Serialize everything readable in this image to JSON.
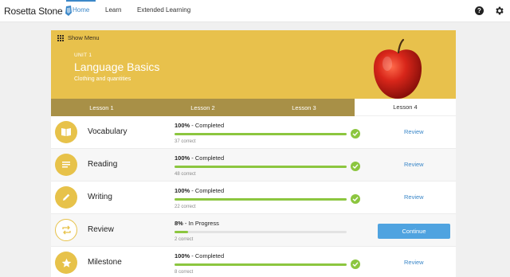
{
  "header": {
    "logo_text": "Rosetta Stone",
    "tabs": [
      "Home",
      "Learn",
      "Extended Learning"
    ],
    "help_symbol": "?",
    "icons": [
      "help-icon",
      "gear-icon"
    ]
  },
  "banner": {
    "show_menu_label": "Show Menu",
    "unit_label": "UNIT 1",
    "unit_title": "Language Basics",
    "unit_subtitle": "Clothing and quantities",
    "background_color": "#e8c14c"
  },
  "lessons": [
    "Lesson 1",
    "Lesson 2",
    "Lesson 3",
    "Lesson 4"
  ],
  "activities": [
    {
      "title": "Vocabulary",
      "percent": "100%",
      "status": " - Completed",
      "progress": 1.0,
      "correct": "37 correct",
      "action": "Review",
      "icon": "book-icon"
    },
    {
      "title": "Reading",
      "percent": "100%",
      "status": " - Completed",
      "progress": 1.0,
      "correct": "48 correct",
      "action": "Review",
      "icon": "document-lines-icon"
    },
    {
      "title": "Writing",
      "percent": "100%",
      "status": " - Completed",
      "progress": 1.0,
      "correct": "22 correct",
      "action": "Review",
      "icon": "pencil-icon"
    },
    {
      "title": "Review",
      "percent": "8%",
      "status": " - In Progress",
      "progress": 0.08,
      "correct": "2 correct",
      "action": "Continue",
      "icon": "repeat-arrows-icon"
    },
    {
      "title": "Milestone",
      "percent": "100%",
      "status": " - Completed",
      "progress": 1.0,
      "correct": "8 correct",
      "action": "Review",
      "icon": "star-icon"
    }
  ],
  "colors": {
    "accent": "#3b87c8",
    "progress": "#8cc63f",
    "icon_bg": "#e7c24a",
    "lesson_bar": "#a89047"
  }
}
